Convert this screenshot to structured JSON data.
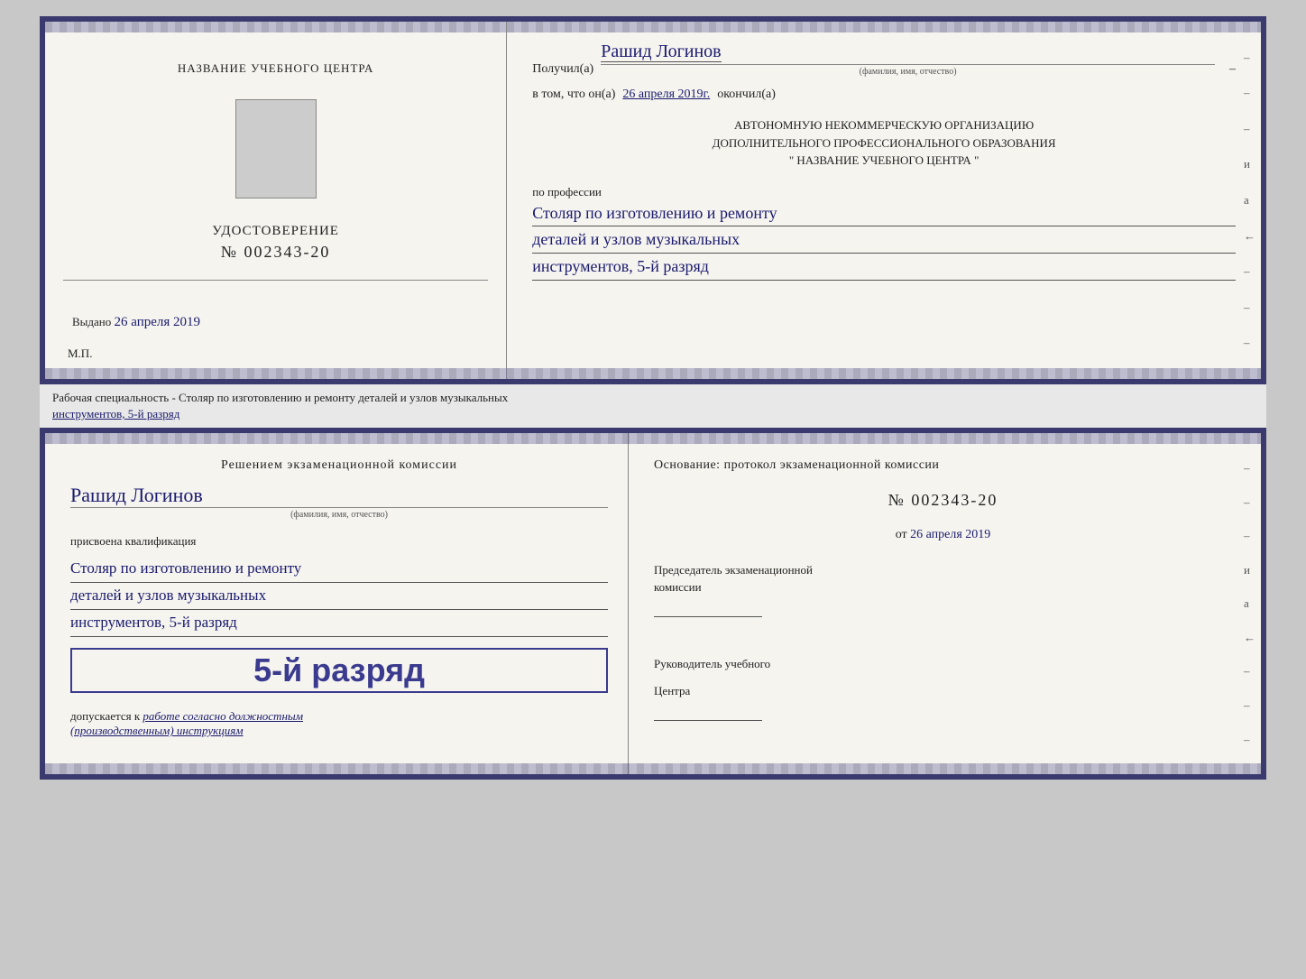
{
  "top_left": {
    "title": "НАЗВАНИЕ УЧЕБНОГО ЦЕНТРА",
    "cert_label": "УДОСТОВЕРЕНИЕ",
    "cert_number": "№ 002343-20",
    "issued_prefix": "Выдано",
    "issued_date": "26 апреля 2019",
    "mp": "М.П."
  },
  "top_right": {
    "recipient_prefix": "Получил(а)",
    "recipient_name": "Рашид Логинов",
    "fio_sub": "(фамилия, имя, отчество)",
    "dash": "–",
    "date_prefix": "в том, что он(а)",
    "date_value": "26 апреля 2019г.",
    "completed": "окончил(а)",
    "institution_line1": "АВТОНОМНУЮ НЕКОММЕРЧЕСКУЮ ОРГАНИЗАЦИЮ",
    "institution_line2": "ДОПОЛНИТЕЛЬНОГО ПРОФЕССИОНАЛЬНОГО ОБРАЗОВАНИЯ",
    "institution_line3": "\"  НАЗВАНИЕ УЧЕБНОГО ЦЕНТРА  \"",
    "profession_label": "по профессии",
    "profession_line1": "Столяр по изготовлению и ремонту",
    "profession_line2": "деталей и узлов музыкальных",
    "profession_line3": "инструментов, 5-й разряд"
  },
  "middle": {
    "text_prefix": "Рабочая специальность - Столяр по изготовлению и ремонту деталей и узлов музыкальных",
    "text_underlined": "инструментов, 5-й разряд"
  },
  "bottom_left": {
    "decision": "Решением экзаменационной комиссии",
    "name": "Рашид Логинов",
    "fio_sub": "(фамилия, имя, отчество)",
    "qualification_prefix": "присвоена квалификация",
    "qualification_line1": "Столяр по изготовлению и ремонту",
    "qualification_line2": "деталей и узлов музыкальных",
    "qualification_line3": "инструментов, 5-й разряд",
    "rank_text": "5-й разряд",
    "допускается_prefix": "допускается к",
    "допускается_value": "работе согласно должностным",
    "допускается_cont": "(производственным) инструкциям"
  },
  "bottom_right": {
    "osnov_text": "Основание: протокол экзаменационной  комиссии",
    "protocol_prefix": "№",
    "protocol_number": "002343-20",
    "date_prefix": "от",
    "date_value": "26 апреля 2019",
    "chairman_label": "Председатель экзаменационной",
    "chairman_label2": "комиссии",
    "head_label": "Руководитель учебного",
    "head_label2": "Центра"
  },
  "dashes": {
    "items": [
      "–",
      "–",
      "–",
      "и",
      "а",
      "←",
      "–",
      "–",
      "–"
    ]
  }
}
